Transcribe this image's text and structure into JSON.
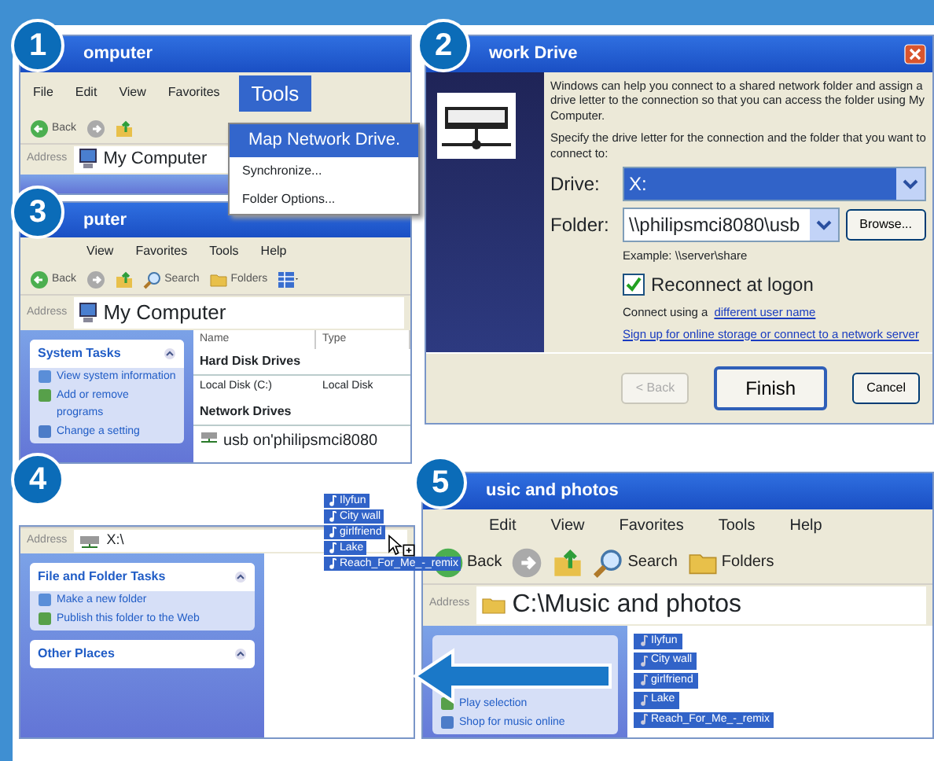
{
  "steps": [
    {
      "number": "1",
      "kind": "menu",
      "title": "omputer",
      "menu": [
        {
          "label": "File",
          "selected": false
        },
        {
          "label": "Edit",
          "selected": false
        },
        {
          "label": "View",
          "selected": false
        },
        {
          "label": "Favorites",
          "selected": false
        },
        {
          "label": "Tools",
          "selected": true
        }
      ],
      "toolbar": [
        {
          "kind": "back",
          "label": "Back"
        },
        {
          "kind": "forward"
        },
        {
          "kind": "up"
        }
      ],
      "address_label": "Address",
      "address": "My Computer",
      "dropdown": [
        {
          "label": "Map Network Drive.",
          "selected": true
        },
        {
          "label": "Synchronize...",
          "selected": false
        },
        {
          "label": "Folder Options...",
          "selected": false
        }
      ]
    },
    {
      "number": "2",
      "kind": "dialog",
      "title": "work Drive",
      "intro": "Windows can help you connect to a shared network folder and assign a drive letter to the connection so that you can access the folder using My Computer.",
      "instruction": "Specify the drive letter for the connection and the folder that you want to connect to:",
      "drive_label": "Drive:",
      "drive": "X:",
      "folder_label": "Folder:",
      "folder": "\\\\philipsmci8080\\usb",
      "browse": "Browse...",
      "example": "Example: \\\\server\\share",
      "reconnect": {
        "label": "Reconnect at logon",
        "checked": true
      },
      "connect_text": "Connect using a",
      "connect_link": "different user name",
      "signup_link": "Sign up for online storage or connect to a network server",
      "buttons": [
        {
          "label": "< Back",
          "disabled": true,
          "default": false
        },
        {
          "label": "Finish",
          "disabled": false,
          "default": true
        },
        {
          "label": "Cancel",
          "disabled": false,
          "default": false
        }
      ]
    },
    {
      "number": "3",
      "kind": "explorer",
      "title": "puter",
      "menu": [
        {
          "label": "View",
          "selected": false
        },
        {
          "label": "Favorites",
          "selected": false
        },
        {
          "label": "Tools",
          "selected": false
        },
        {
          "label": "Help",
          "selected": false
        }
      ],
      "toolbar": [
        {
          "kind": "back",
          "label": "Back"
        },
        {
          "kind": "forward"
        },
        {
          "kind": "up"
        },
        {
          "kind": "search",
          "label": "Search"
        },
        {
          "kind": "folders",
          "label": "Folders"
        },
        {
          "kind": "views"
        }
      ],
      "address_label": "Address",
      "address": "My Computer",
      "task_title": "System Tasks",
      "tasks": [
        "View system information",
        "Add or remove programs",
        "Change a setting"
      ],
      "columns": [
        "Name",
        "Type"
      ],
      "groups": [
        {
          "title": "Hard Disk Drives",
          "rows": [
            {
              "name": "Local Disk (C:)",
              "type": "Local Disk"
            }
          ]
        },
        {
          "title": "Network Drives",
          "rows": [
            {
              "name": "usb on'philipsmci8080"
            }
          ]
        }
      ]
    },
    {
      "number": "4",
      "kind": "drop",
      "address_label": "Address",
      "address": "X:\\",
      "panes": [
        {
          "title": "File and Folder Tasks",
          "tasks": [
            "Make a new folder",
            "Publish this folder to the Web"
          ]
        },
        {
          "title": "Other Places"
        }
      ],
      "dragged": [
        "Ilyfun",
        "City wall",
        "girlfriend",
        "Lake",
        "Reach_For_Me_-_remix"
      ]
    },
    {
      "number": "5",
      "kind": "source",
      "title": "usic and photos",
      "menu": [
        {
          "label": "Edit",
          "selected": false
        },
        {
          "label": "View",
          "selected": false
        },
        {
          "label": "Favorites",
          "selected": false
        },
        {
          "label": "Tools",
          "selected": false
        },
        {
          "label": "Help",
          "selected": false
        }
      ],
      "toolbar": [
        {
          "kind": "back",
          "label": "Back"
        },
        {
          "kind": "forward"
        },
        {
          "kind": "up"
        },
        {
          "kind": "search",
          "label": "Search"
        },
        {
          "kind": "folders",
          "label": "Folders"
        }
      ],
      "address_label": "Address",
      "address": "C:\\Music and photos",
      "tasks": [
        "Play selection",
        "Shop for music online"
      ],
      "files": [
        {
          "name": "Ilyfun",
          "selected": true
        },
        {
          "name": "City wall",
          "selected": true
        },
        {
          "name": "girlfriend",
          "selected": true
        },
        {
          "name": "Lake",
          "selected": true
        },
        {
          "name": "Reach_For_Me_-_remix",
          "selected": true
        }
      ]
    }
  ]
}
